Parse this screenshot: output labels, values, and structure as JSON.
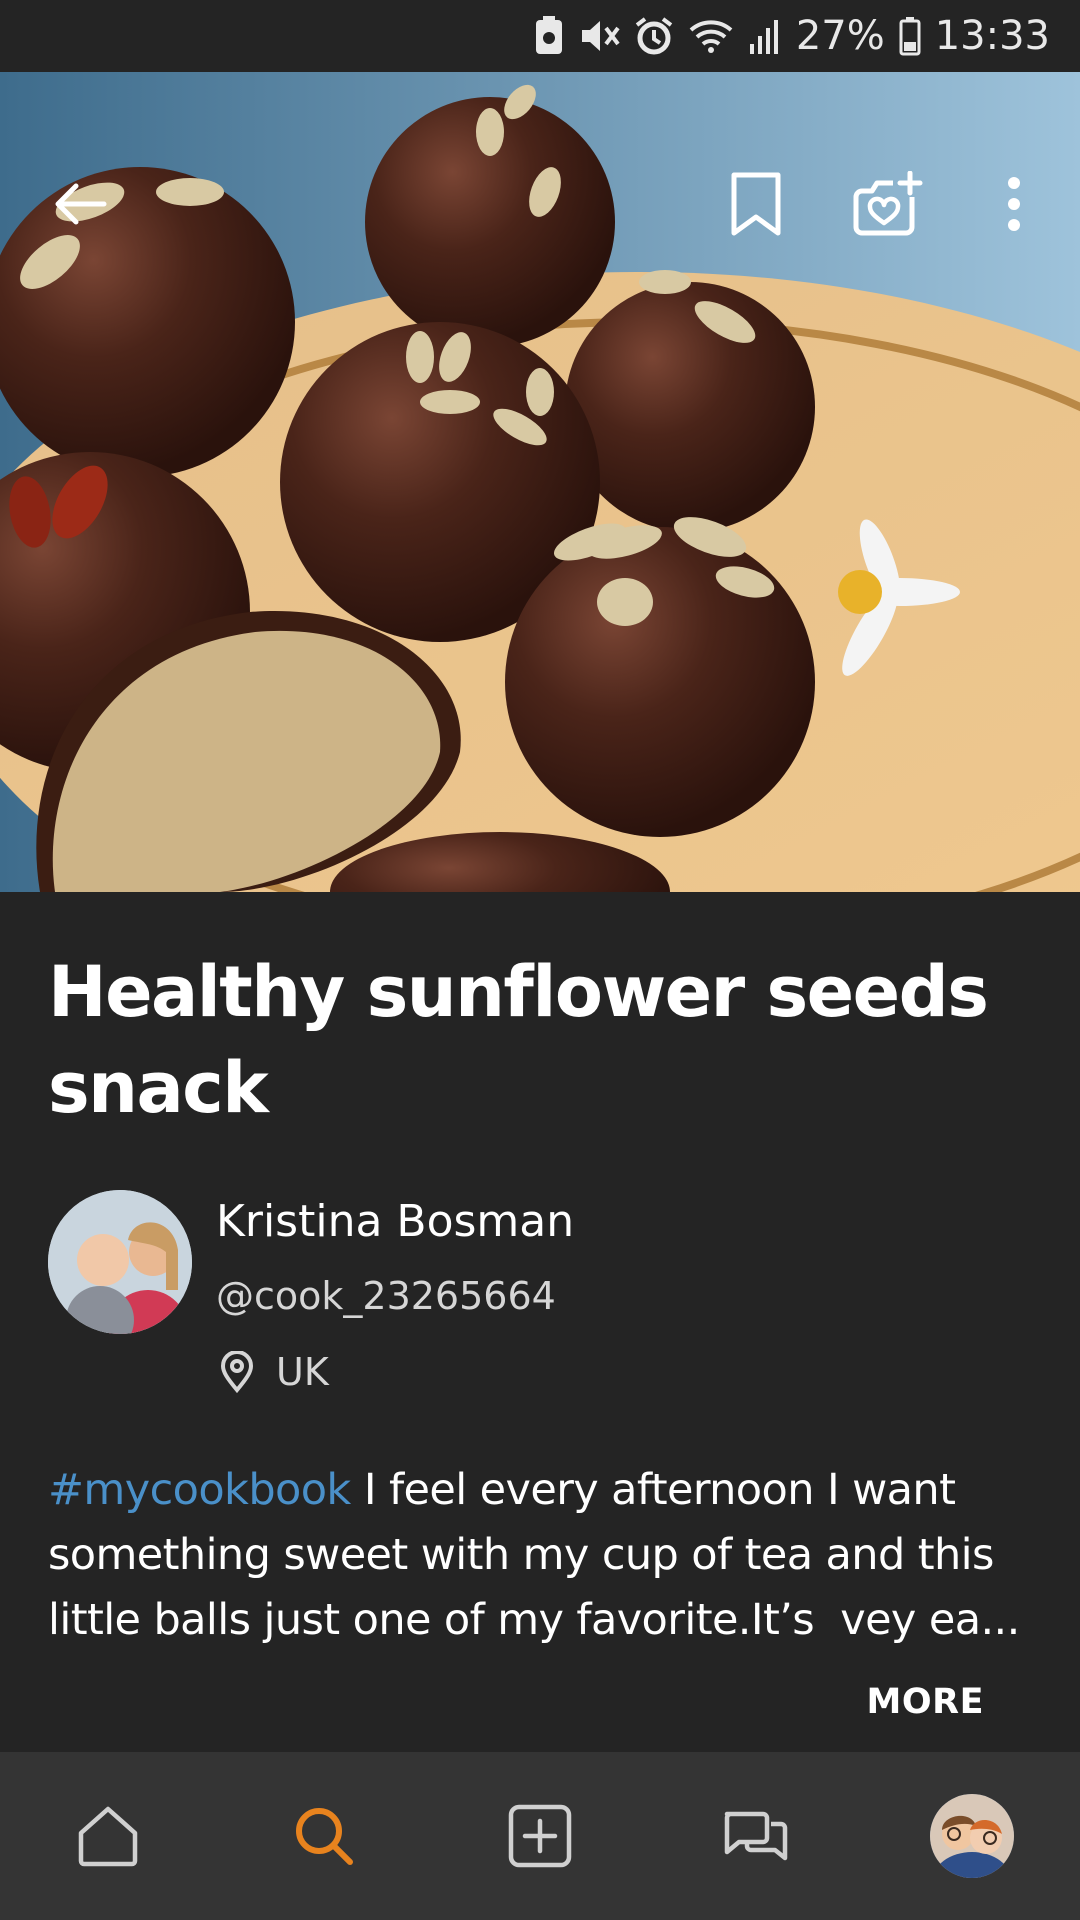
{
  "status_bar": {
    "battery_percent": "27%",
    "time": "13:33",
    "icons": [
      "battery-saver-icon",
      "mute-icon",
      "alarm-icon",
      "wifi-icon",
      "signal-icon",
      "battery-icon"
    ]
  },
  "header": {
    "icons": [
      "back-arrow-icon",
      "bookmark-icon",
      "add-cooksnap-icon",
      "more-options-icon"
    ]
  },
  "recipe": {
    "title": "Healthy sunflower seeds snack",
    "author": {
      "name": "Kristina Bosman",
      "handle": "@cook_23265664",
      "location": "UK"
    },
    "description_hashtag": "#mycookbook",
    "description_text": " I feel every afternoon I want something sweet with my cup of tea and this little balls just one of my favorite.It’s  vey ea...",
    "more_label": "MORE"
  },
  "bottom_nav": {
    "items": [
      "home-icon",
      "search-icon",
      "add-recipe-icon",
      "chat-icon",
      "profile-avatar"
    ],
    "active": "search",
    "active_color": "#e8831e"
  },
  "colors": {
    "background": "#242424",
    "nav_background": "#343434",
    "hashtag": "#4a90c9",
    "accent": "#e8831e"
  }
}
